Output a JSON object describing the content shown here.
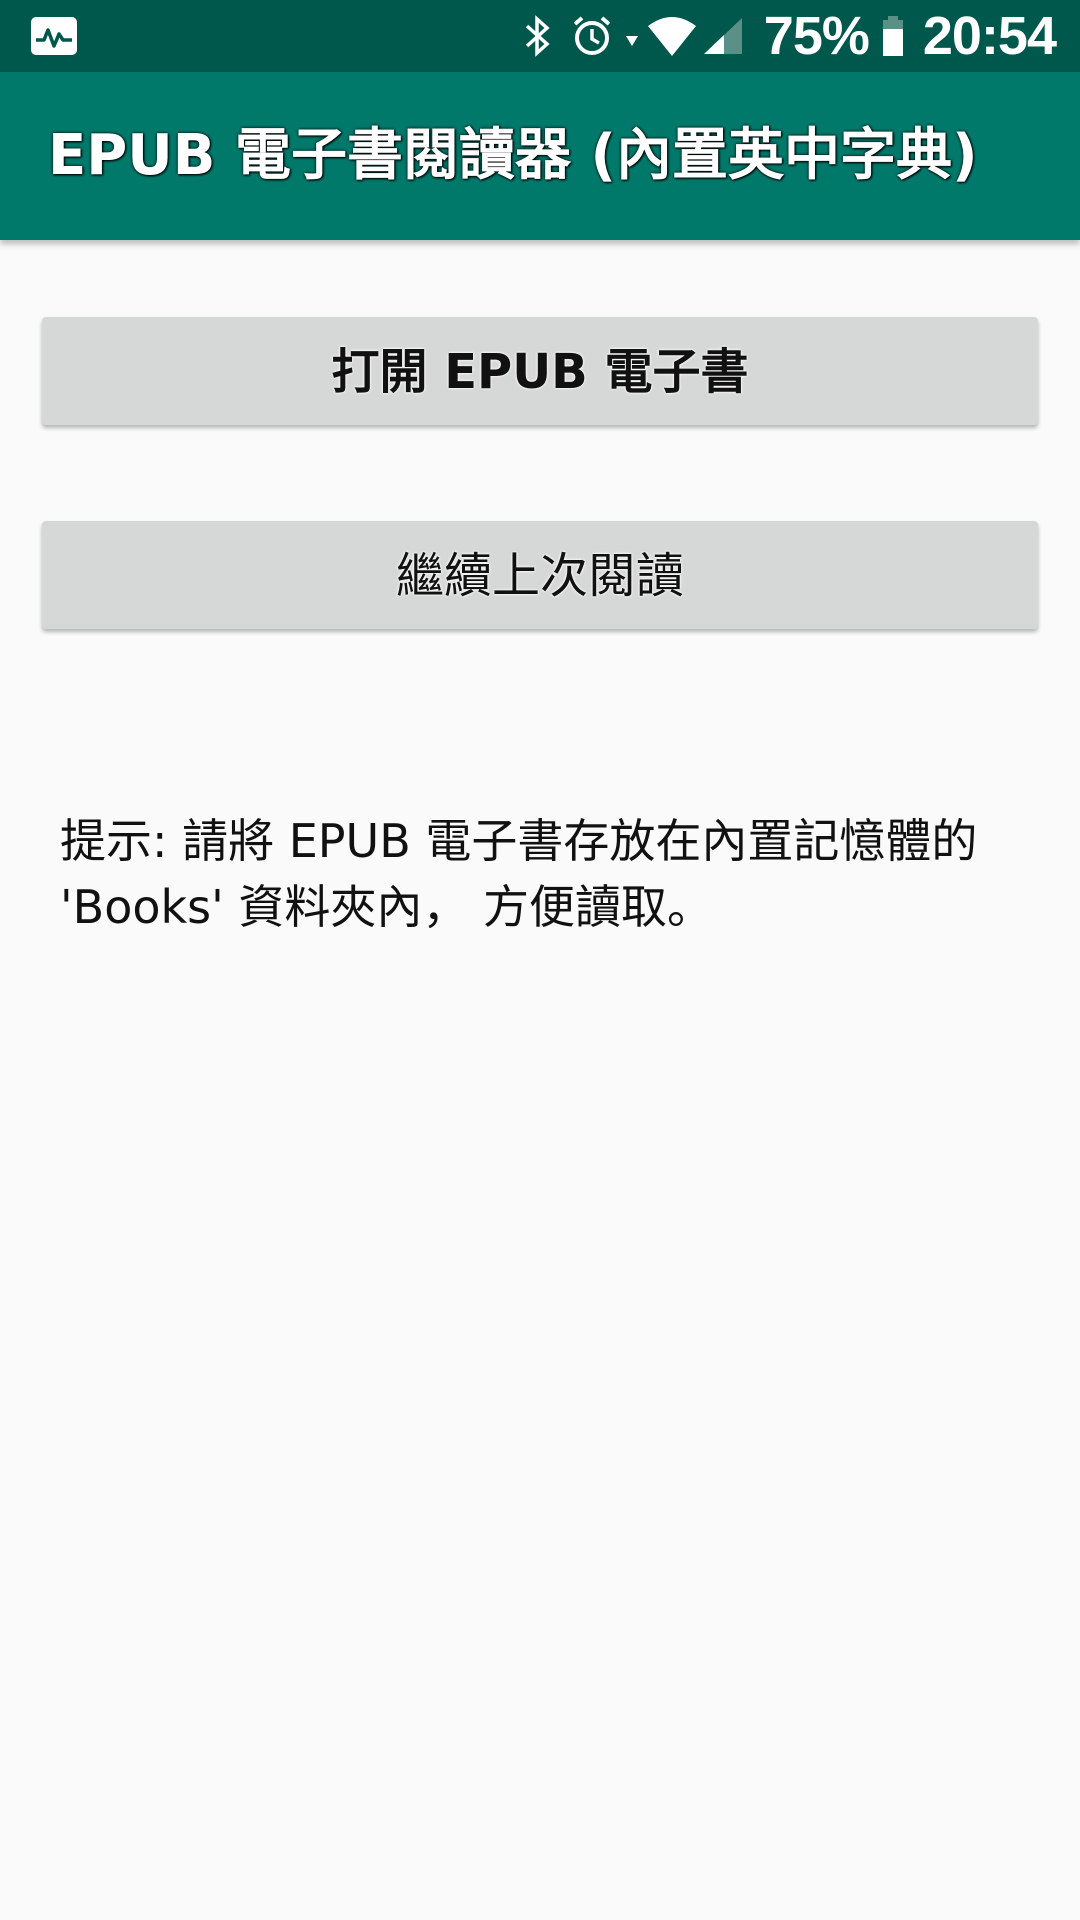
{
  "status_bar": {
    "battery_percent": "75%",
    "time": "20:54",
    "icons": [
      "pulse-app-icon",
      "bluetooth-icon",
      "alarm-icon",
      "wifi-icon",
      "cell-signal-icon",
      "battery-icon"
    ]
  },
  "app_bar": {
    "title": "EPUB 電子書閱讀器 (內置英中字典)",
    "color": "#00796b"
  },
  "buttons": {
    "open_epub": "打開 EPUB 電子書",
    "continue_reading": "繼續上次閱讀"
  },
  "hint": {
    "text": "提示: 請將 EPUB 電子書存放在內置記憶體的 'Books' 資料夾內， 方便讀取。"
  }
}
